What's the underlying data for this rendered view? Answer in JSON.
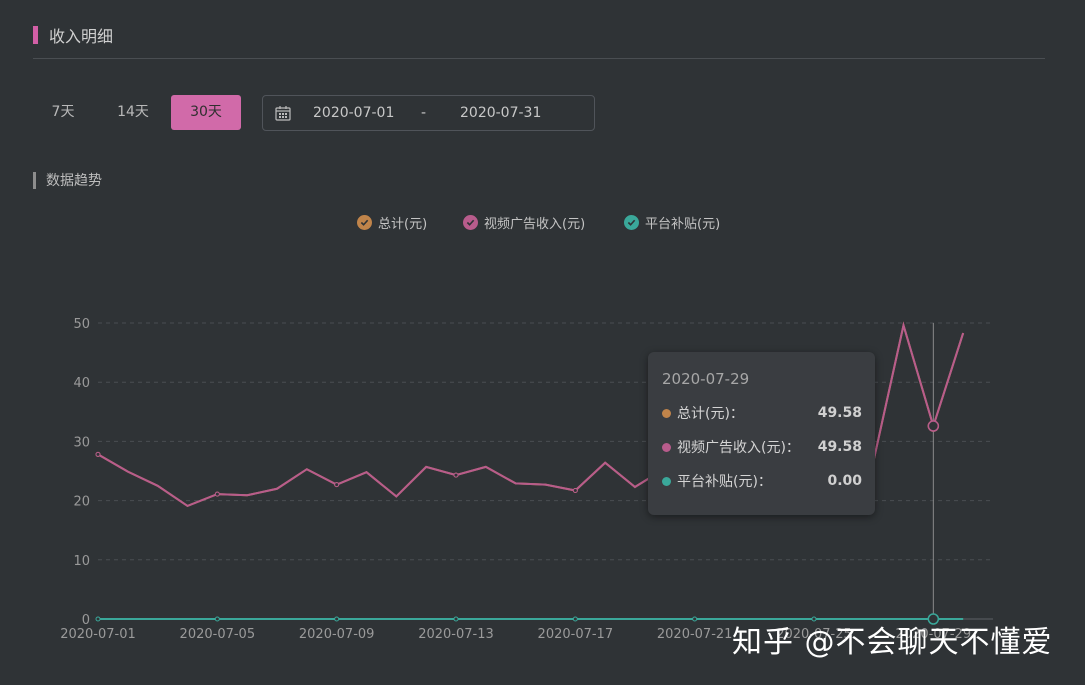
{
  "header": {
    "title": "收入明细"
  },
  "range_buttons": [
    {
      "label": "7天",
      "active": false
    },
    {
      "label": "14天",
      "active": false
    },
    {
      "label": "30天",
      "active": true
    }
  ],
  "date_range": {
    "start": "2020-07-01",
    "separator": "-",
    "end": "2020-07-31",
    "icon": "calendar-icon"
  },
  "section": {
    "title": "数据趋势"
  },
  "colors": {
    "total": "#c0844a",
    "ad": "#b85c8c",
    "subsidy": "#3aa89a",
    "accent": "#d16aa9"
  },
  "tooltip": {
    "date": "2020-07-29",
    "rows": [
      {
        "name": "总计(元)：",
        "value": "49.58"
      },
      {
        "name": "视频广告收入(元)：",
        "value": "49.58"
      },
      {
        "name": "平台补贴(元)：",
        "value": "0.00"
      }
    ]
  },
  "watermark": "知乎 @不会聊天不懂爱",
  "chart_data": {
    "type": "line",
    "x": [
      "2020-07-01",
      "2020-07-02",
      "2020-07-03",
      "2020-07-04",
      "2020-07-05",
      "2020-07-06",
      "2020-07-07",
      "2020-07-08",
      "2020-07-09",
      "2020-07-10",
      "2020-07-11",
      "2020-07-12",
      "2020-07-13",
      "2020-07-14",
      "2020-07-15",
      "2020-07-16",
      "2020-07-17",
      "2020-07-18",
      "2020-07-19",
      "2020-07-20",
      "2020-07-21",
      "2020-07-22",
      "2020-07-23",
      "2020-07-24",
      "2020-07-25",
      "2020-07-26",
      "2020-07-27",
      "2020-07-28",
      "2020-07-29",
      "2020-07-30",
      "2020-07-31"
    ],
    "x_tick_labels": [
      "2020-07-01",
      "2020-07-05",
      "2020-07-09",
      "2020-07-13",
      "2020-07-17",
      "2020-07-21",
      "2020-07-25",
      "2020-07-29"
    ],
    "series": [
      {
        "name": "总计(元)",
        "values": [
          27.8,
          24.9,
          22.5,
          19.1,
          21.1,
          20.9,
          22.0,
          25.3,
          22.7,
          24.8,
          20.7,
          25.7,
          24.3,
          25.7,
          22.9,
          22.7,
          21.7,
          26.4,
          22.3,
          25.4,
          23.6,
          25.3,
          24.6,
          25.5,
          27.3,
          30.4,
          26.8,
          49.6,
          32.6,
          48.3
        ]
      },
      {
        "name": "视频广告收入(元)",
        "values": [
          27.8,
          24.9,
          22.5,
          19.1,
          21.1,
          20.9,
          22.0,
          25.3,
          22.7,
          24.8,
          20.7,
          25.7,
          24.3,
          25.7,
          22.9,
          22.7,
          21.7,
          26.4,
          22.3,
          25.4,
          23.6,
          25.3,
          24.6,
          25.5,
          27.3,
          30.4,
          26.8,
          49.6,
          32.6,
          48.3
        ]
      },
      {
        "name": "平台补贴(元)",
        "values": [
          0,
          0,
          0,
          0,
          0,
          0,
          0,
          0,
          0,
          0,
          0,
          0,
          0,
          0,
          0,
          0,
          0,
          0,
          0,
          0,
          0,
          0,
          0,
          0,
          0,
          0,
          0,
          0,
          0,
          0
        ]
      }
    ],
    "y_ticks": [
      0,
      10,
      20,
      30,
      40,
      50
    ],
    "ylim": [
      0,
      50
    ],
    "grid": true,
    "legend_position": "top-center",
    "highlighted_x": "2020-07-29"
  }
}
